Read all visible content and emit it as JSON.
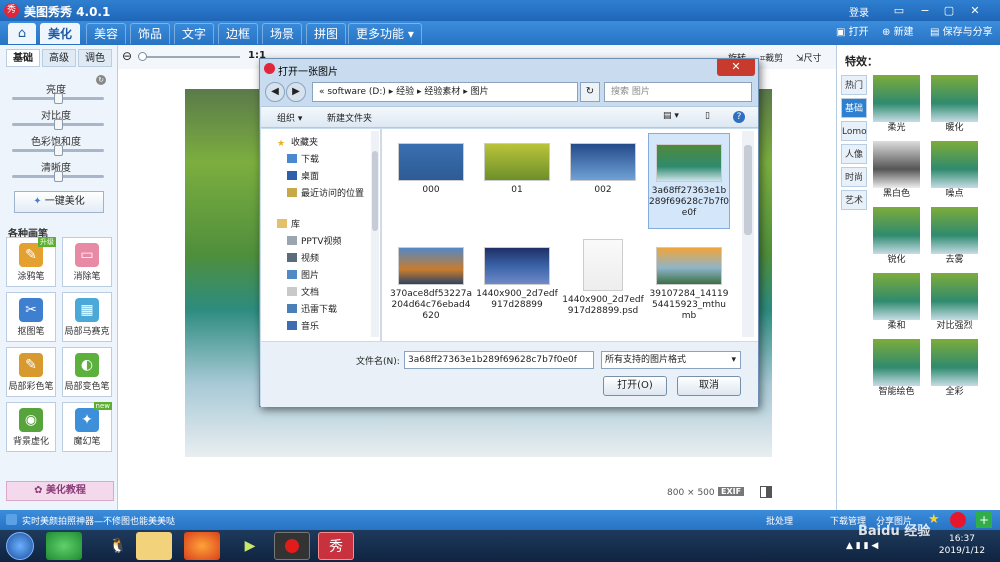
{
  "app": {
    "logo": "秀",
    "title": "美图秀秀 4.0.1",
    "login": "登录"
  },
  "window_controls": [
    "▭",
    "−",
    "▢",
    "✕"
  ],
  "menu": {
    "tabs": [
      "美化",
      "美容",
      "饰品",
      "文字",
      "边框",
      "场景",
      "拼图",
      "更多功能 ▾"
    ],
    "actions": {
      "open": "打开",
      "new": "新建",
      "save": "保存与分享"
    }
  },
  "left": {
    "subtabs": [
      "基础",
      "高级",
      "调色"
    ],
    "sliders": [
      "亮度",
      "对比度",
      "色彩饱和度",
      "清晰度"
    ],
    "auto_button": "一键美化",
    "brush_title": "各种画笔",
    "tools": [
      {
        "label": "涂鸦笔",
        "badge": "升级",
        "color": "#e4a12f",
        "icon": "✎"
      },
      {
        "label": "消除笔",
        "badge": "",
        "color": "#e88aa5",
        "icon": "▭"
      },
      {
        "label": "抠图笔",
        "badge": "",
        "color": "#3f7fd0",
        "icon": "✂"
      },
      {
        "label": "局部马赛克",
        "badge": "",
        "color": "#4aa9d8",
        "icon": "▦"
      },
      {
        "label": "局部彩色笔",
        "badge": "",
        "color": "#d89a2f",
        "icon": "✎"
      },
      {
        "label": "局部变色笔",
        "badge": "",
        "color": "#5bb13b",
        "icon": "◐"
      },
      {
        "label": "背景虚化",
        "badge": "",
        "color": "#57a43c",
        "icon": "◉"
      },
      {
        "label": "魔幻笔",
        "badge": "new",
        "color": "#3e8fd9",
        "icon": "✦"
      }
    ],
    "tutorial": "美化教程"
  },
  "canvas": {
    "zoom_value": "1:1",
    "size": "800 × 500",
    "exif": "EXIF"
  },
  "canvas_tools": {
    "rotate": "旋转",
    "crop": "裁剪",
    "resize": "尺寸"
  },
  "right": {
    "title": "特效：",
    "tabs": [
      "热门",
      "基础",
      "Lomo",
      "人像",
      "时尚",
      "艺术"
    ],
    "effects": [
      "柔光",
      "暖化",
      "黑白色",
      "噪点",
      "锐化",
      "去雾",
      "柔和",
      "对比强烈",
      "智能绘色",
      "全彩"
    ]
  },
  "status": {
    "tip": "实时美颜拍照神器—不修图也能美美哒",
    "batch": "批处理",
    "download": "下载管理",
    "share": "分享图片"
  },
  "dialog": {
    "title": "打开一张图片",
    "address": "« software (D:) ▸ 经验 ▸ 经验素材 ▸ 图片",
    "search_placeholder": "搜索 图片",
    "organize": "组织 ▾",
    "new_folder": "新建文件夹",
    "nav": {
      "favorites": "收藏夹",
      "fav_items": [
        "下载",
        "桌面",
        "最近访问的位置"
      ],
      "library": "库",
      "lib_items": [
        "PPTV视频",
        "视频",
        "图片",
        "文档",
        "迅雷下载",
        "音乐"
      ]
    },
    "files": [
      {
        "name": "000",
        "thumb": "linear-gradient(#3a6fb0,#2d5b95)"
      },
      {
        "name": "01",
        "thumb": "linear-gradient(#b9c43a,#6d8f2a)"
      },
      {
        "name": "002",
        "thumb": "linear-gradient(#244a8a,#6fa2d6)"
      },
      {
        "name": "3a68ff27363e1b289f69628c7b7f0e0f",
        "thumb": "linear-gradient(#4f8a3c,#2f8a6e 60%,#cfe3ea)"
      },
      {
        "name": "370ace8df53227a204d64c76ebad4620",
        "thumb": "linear-gradient(#5488c4,#c87c2d 60%,#2d4466)"
      },
      {
        "name": "1440x900_2d7edf917d28899",
        "thumb": "linear-gradient(#1e2f66,#3b63a8 50%,#6f8ac7)"
      },
      {
        "name": "1440x900_2d7edf917d28899.psd",
        "thumb": "linear-gradient(#fafafa,#ededed)"
      },
      {
        "name": "39107284_1411954415923_mthumb",
        "thumb": "linear-gradient(#f0a43a,#8fb5c9 55%,#3b6f46)"
      }
    ],
    "filename_label": "文件名(N):",
    "filename_value": "3a68ff27363e1b289f69628c7b7f0e0f",
    "filetype": "所有支持的图片格式",
    "open": "打开(O)",
    "cancel": "取消"
  },
  "taskbar": {
    "time": "16:37",
    "date": "2019/1/12"
  },
  "watermark": "Baidu 经验"
}
